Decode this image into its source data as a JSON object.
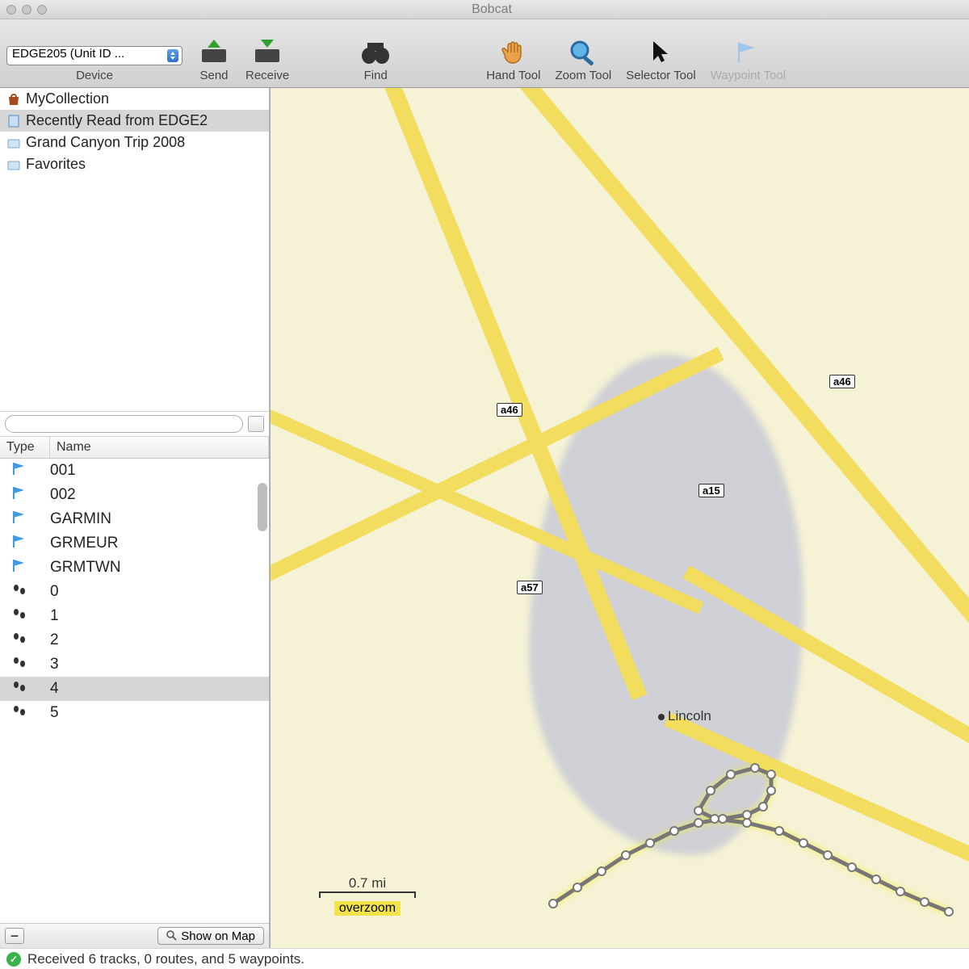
{
  "window": {
    "title": "Bobcat"
  },
  "toolbar": {
    "device_selector": "EDGE205 (Unit ID ...",
    "device_group_label": "Device",
    "send": "Send",
    "receive": "Receive",
    "find": "Find",
    "hand": "Hand Tool",
    "zoom": "Zoom Tool",
    "selector": "Selector Tool",
    "waypoint": "Waypoint Tool"
  },
  "collections": [
    {
      "icon": "bag",
      "label": "MyCollection"
    },
    {
      "icon": "doc",
      "label": "Recently Read from EDGE2"
    },
    {
      "icon": "folder",
      "label": "Grand Canyon Trip 2008"
    },
    {
      "icon": "folder",
      "label": "Favorites"
    }
  ],
  "list": {
    "headers": {
      "type": "Type",
      "name": "Name"
    },
    "rows": [
      {
        "kind": "wp",
        "name": "001"
      },
      {
        "kind": "wp",
        "name": "002"
      },
      {
        "kind": "wp",
        "name": "GARMIN"
      },
      {
        "kind": "wp",
        "name": "GRMEUR"
      },
      {
        "kind": "wp",
        "name": "GRMTWN"
      },
      {
        "kind": "trk",
        "name": "0"
      },
      {
        "kind": "trk",
        "name": "1"
      },
      {
        "kind": "trk",
        "name": "2"
      },
      {
        "kind": "trk",
        "name": "3"
      },
      {
        "kind": "trk",
        "name": "4",
        "selected": true
      },
      {
        "kind": "trk",
        "name": "5"
      }
    ]
  },
  "sidebar_footer": {
    "show_on_map": "Show on Map"
  },
  "map": {
    "place_label": "Lincoln",
    "shields": [
      "a46",
      "a15",
      "a46",
      "a57"
    ],
    "scale": "0.7 mi",
    "overzoom": "overzoom"
  },
  "status": {
    "text": "Received 6 tracks, 0 routes, and 5 waypoints."
  }
}
